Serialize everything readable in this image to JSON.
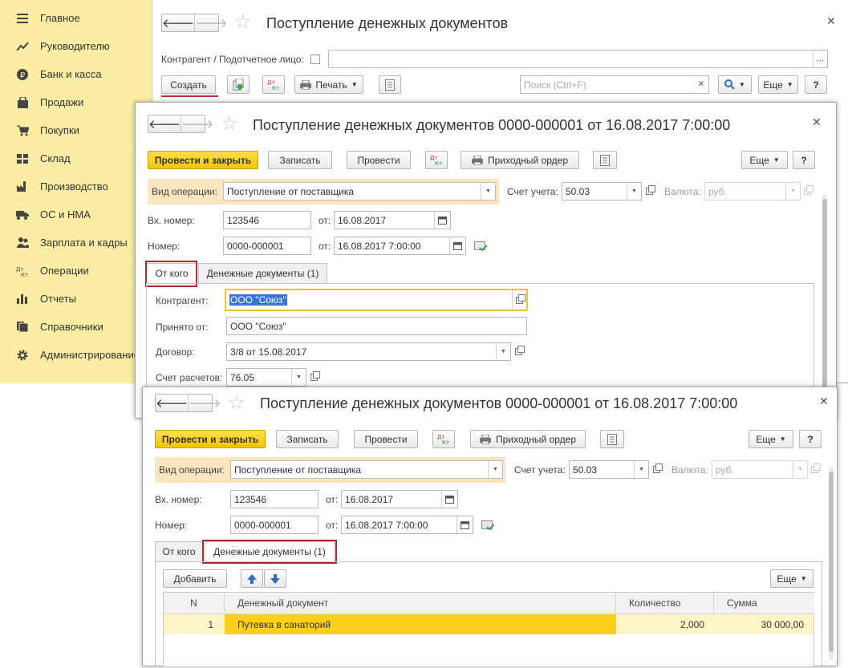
{
  "sidebar": {
    "items": [
      {
        "label": "Главное",
        "icon": "menu-icon"
      },
      {
        "label": "Руководителю",
        "icon": "trend-icon"
      },
      {
        "label": "Банк и касса",
        "icon": "ruble-icon"
      },
      {
        "label": "Продажи",
        "icon": "bag-icon"
      },
      {
        "label": "Покупки",
        "icon": "cart-icon"
      },
      {
        "label": "Склад",
        "icon": "warehouse-icon"
      },
      {
        "label": "Производство",
        "icon": "factory-icon"
      },
      {
        "label": "ОС и НМА",
        "icon": "truck-icon"
      },
      {
        "label": "Зарплата и кадры",
        "icon": "people-icon"
      },
      {
        "label": "Операции",
        "icon": "dt-kt-icon"
      },
      {
        "label": "Отчеты",
        "icon": "bar-chart-icon"
      },
      {
        "label": "Справочники",
        "icon": "books-icon"
      },
      {
        "label": "Администрирование",
        "icon": "gear-icon"
      }
    ]
  },
  "list_window": {
    "title": "Поступление денежных документов",
    "counterparty_label": "Контрагент / Подотчетное лицо:",
    "counterparty_value": "",
    "create_label": "Создать",
    "print_label": "Печать",
    "search_placeholder": "Поиск (Ctrl+F)",
    "more_label": "Еще",
    "help_label": "?"
  },
  "doc_window_1": {
    "title": "Поступление денежных документов 0000-000001 от 16.08.2017 7:00:00",
    "post_close_label": "Провести и закрыть",
    "save_label": "Записать",
    "post_label": "Провести",
    "receipt_order_label": "Приходный ордер",
    "more_label": "Еще",
    "help_label": "?",
    "operation_label": "Вид операции:",
    "operation_value": "Поступление от поставщика",
    "account_label": "Счет учета:",
    "account_value": "50.03",
    "currency_label": "Валюта:",
    "currency_value": "руб.",
    "in_number_label": "Вх. номер:",
    "in_number_value": "123546",
    "from_label": "от:",
    "in_date_value": "16.08.2017",
    "number_label": "Номер:",
    "number_value": "0000-000001",
    "date_value": "16.08.2017  7:00:00",
    "tab_from": "От кого",
    "tab_docs": "Денежные документы (1)",
    "counterparty_label": "Контрагент:",
    "counterparty_value": "ООО \"Союз\"",
    "received_from_label": "Принято от:",
    "received_from_value": "ООО \"Союз\"",
    "contract_label": "Договор:",
    "contract_value": "3/8 от 15.08.2017",
    "settlement_label": "Счет расчетов:",
    "settlement_value": "76.05"
  },
  "doc_window_2": {
    "title": "Поступление денежных документов 0000-000001 от 16.08.2017 7:00:00",
    "post_close_label": "Провести и закрыть",
    "save_label": "Записать",
    "post_label": "Провести",
    "receipt_order_label": "Приходный ордер",
    "more_label": "Еще",
    "help_label": "?",
    "operation_label": "Вид операции:",
    "operation_value": "Поступление от поставщика",
    "account_label": "Счет учета:",
    "account_value": "50.03",
    "currency_label": "Валюта:",
    "currency_value": "руб.",
    "in_number_label": "Вх. номер:",
    "in_number_value": "123546",
    "from_label": "от:",
    "in_date_value": "16.08.2017",
    "number_label": "Номер:",
    "number_value": "0000-000001",
    "date_value": "16.08.2017  7:00:00",
    "tab_from": "От кого",
    "tab_docs": "Денежные документы (1)",
    "add_label": "Добавить",
    "more_label_2": "Еще",
    "table": {
      "headers": [
        "N",
        "Денежный документ",
        "Количество",
        "Сумма"
      ],
      "rows": [
        {
          "n": "1",
          "doc": "Путевка в санаторий",
          "qty": "2,000",
          "sum": "30 000,00"
        }
      ]
    }
  },
  "colors": {
    "sidebar_bg": "#fbeda3",
    "primary_button": "#f4c400",
    "highlight_border": "#b3262a",
    "selected_row": "#fbd11d"
  }
}
